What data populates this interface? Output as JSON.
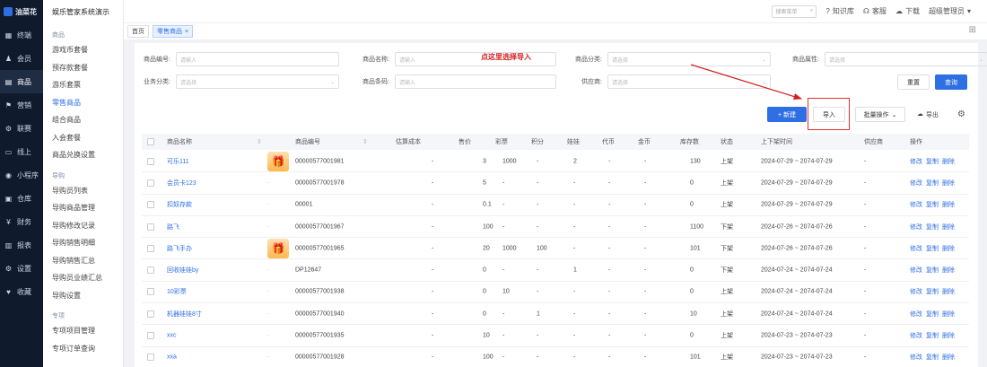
{
  "rail": {
    "logo": "油菜花",
    "items": [
      {
        "icon": "▦",
        "label": "终端"
      },
      {
        "icon": "♟",
        "label": "会员"
      },
      {
        "icon": "▤",
        "label": "商品"
      },
      {
        "icon": "⚑",
        "label": "营销"
      },
      {
        "icon": "⚙",
        "label": "联赛"
      },
      {
        "icon": "▭",
        "label": "线上"
      },
      {
        "icon": "◉",
        "label": "小程序"
      },
      {
        "icon": "▣",
        "label": "仓库"
      },
      {
        "icon": "¥",
        "label": "财务"
      },
      {
        "icon": "▥",
        "label": "报表"
      },
      {
        "icon": "⚙",
        "label": "设置"
      },
      {
        "icon": "♥",
        "label": "收藏"
      }
    ]
  },
  "submenu": {
    "app_title": "娱乐管家系统演示",
    "group1": "商品",
    "links1": [
      "游戏币套餐",
      "预存款套餐",
      "游乐套票",
      "零售商品",
      "组合商品",
      "入会套餐",
      "商品兑换设置"
    ],
    "group2": "导购",
    "links2": [
      "导购员列表",
      "导购商品管理",
      "导购修改记录",
      "导购销售明细",
      "导购销售汇总",
      "导购员业绩汇总",
      "导购设置"
    ],
    "group3": "专项",
    "links3": [
      "专项项目管理",
      "专项订单查询"
    ]
  },
  "topbar": {
    "search_placeholder": "搜索菜单",
    "knowledge": "知识库",
    "service": "客服",
    "download": "下载",
    "user": "超级管理员"
  },
  "tabs": [
    "首页",
    "零售商品"
  ],
  "filters": {
    "code_label": "商品编号:",
    "code_ph": "请输入",
    "name_label": "商品名称:",
    "name_ph": "请输入",
    "category_label": "商品分类:",
    "category_ph": "请选择",
    "attr_label": "商品属性:",
    "attr_ph": "请选择",
    "biz_label": "业务分类:",
    "biz_ph": "请选择",
    "barcode_label": "商品条码:",
    "barcode_ph": "请输入",
    "supplier_label": "供应商:",
    "supplier_ph": "请选择"
  },
  "buttons": {
    "reset": "重置",
    "query": "查询",
    "new": "+ 新建",
    "import": "导入",
    "batch": "批量操作",
    "export": "导出"
  },
  "annotation": "点这里选择导入",
  "table": {
    "headers": [
      "商品名称",
      "商品编号",
      "估算成本",
      "售价",
      "彩票",
      "积分",
      "娃娃",
      "代币",
      "金币",
      "库存数",
      "状态",
      "上下架时间",
      "供应商",
      "操作"
    ],
    "ops": [
      "修改",
      "复制",
      "删除"
    ],
    "rows": [
      {
        "name": "可乐111",
        "thumb": true,
        "code": "00000577001981",
        "cost": "-",
        "price": "3",
        "ticket": "1000",
        "points": "-",
        "doll": "2",
        "token": "-",
        "gold": "-",
        "stock": "130",
        "status": "上架",
        "time": "2024-07-29 ~ 2074-07-29",
        "supplier": "-"
      },
      {
        "name": "会员卡123",
        "thumb": false,
        "code": "00000577001978",
        "cost": "-",
        "price": "5",
        "ticket": "-",
        "points": "-",
        "doll": "-",
        "token": "-",
        "gold": "-",
        "stock": "0",
        "status": "上架",
        "time": "2024-07-29 ~ 2074-07-29",
        "supplier": "-"
      },
      {
        "name": "扣奴存款",
        "thumb": false,
        "code": "00001",
        "cost": "-",
        "price": "0.1",
        "ticket": "-",
        "points": "-",
        "doll": "-",
        "token": "-",
        "gold": "-",
        "stock": "0",
        "status": "上架",
        "time": "2024-07-29 ~ 2074-07-29",
        "supplier": "-"
      },
      {
        "name": "路飞",
        "thumb": false,
        "code": "00000577001967",
        "cost": "-",
        "price": "100",
        "ticket": "-",
        "points": "-",
        "doll": "-",
        "token": "-",
        "gold": "-",
        "stock": "1100",
        "status": "下架",
        "time": "2024-07-26 ~ 2074-07-26",
        "supplier": "-"
      },
      {
        "name": "路飞手办",
        "thumb": true,
        "code": "00000577001965",
        "cost": "-",
        "price": "20",
        "ticket": "1000",
        "points": "100",
        "doll": "-",
        "token": "-",
        "gold": "-",
        "stock": "101",
        "status": "下架",
        "time": "2024-07-26 ~ 2074-07-26",
        "supplier": "-"
      },
      {
        "name": "回收娃娃by",
        "thumb": false,
        "code": "DP12647",
        "cost": "-",
        "price": "0",
        "ticket": "-",
        "points": "-",
        "doll": "1",
        "token": "-",
        "gold": "-",
        "stock": "0",
        "status": "下架",
        "time": "2024-07-24 ~ 2074-07-24",
        "supplier": "-"
      },
      {
        "name": "10彩票",
        "thumb": false,
        "code": "00000577001938",
        "cost": "-",
        "price": "0",
        "ticket": "10",
        "points": "-",
        "doll": "-",
        "token": "-",
        "gold": "-",
        "stock": "0",
        "status": "上架",
        "time": "2024-07-24 ~ 2074-07-24",
        "supplier": "-"
      },
      {
        "name": "机器娃娃8寸",
        "thumb": false,
        "code": "00000577001940",
        "cost": "-",
        "price": "0",
        "ticket": "-",
        "points": "1",
        "doll": "-",
        "token": "-",
        "gold": "-",
        "stock": "10",
        "status": "上架",
        "time": "2024-07-24 ~ 2074-07-24",
        "supplier": "-"
      },
      {
        "name": "xxc",
        "thumb": false,
        "code": "00000577001935",
        "cost": "-",
        "price": "10",
        "ticket": "-",
        "points": "-",
        "doll": "-",
        "token": "-",
        "gold": "-",
        "stock": "0",
        "status": "上架",
        "time": "2024-07-23 ~ 2074-07-23",
        "supplier": "-"
      },
      {
        "name": "xxa",
        "thumb": false,
        "code": "00000577001928",
        "cost": "-",
        "price": "100",
        "ticket": "-",
        "points": "-",
        "doll": "-",
        "token": "-",
        "gold": "-",
        "stock": "101",
        "status": "上架",
        "time": "2024-07-23 ~ 2074-07-23",
        "supplier": "-"
      }
    ]
  },
  "colors": {
    "accent": "#2f6fe4",
    "sidebar": "#0f1a2c",
    "annotation": "#d32020"
  }
}
